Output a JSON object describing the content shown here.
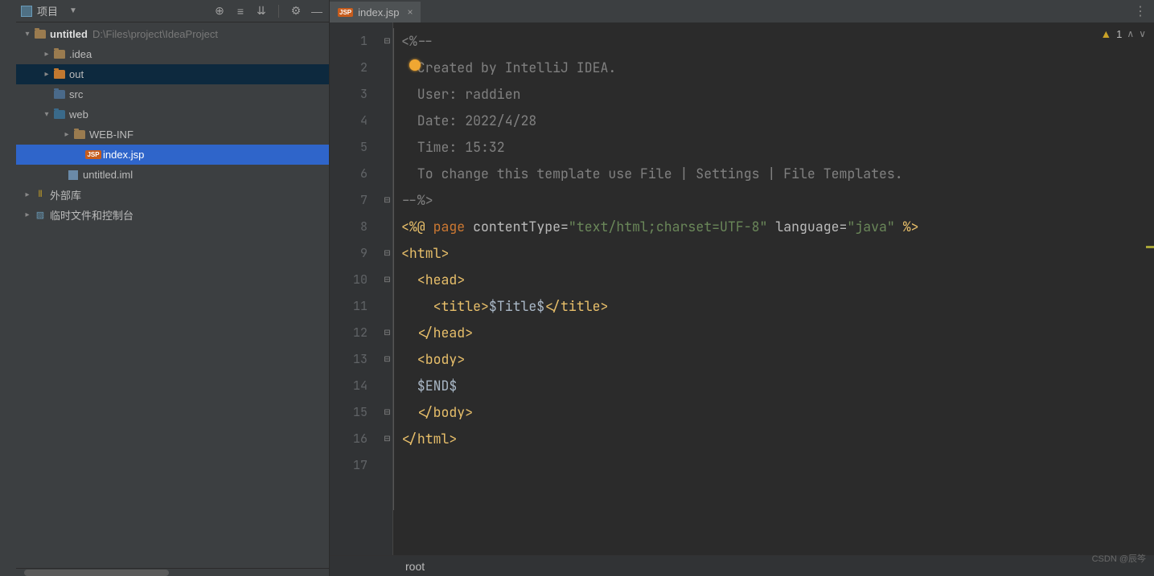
{
  "panel": {
    "title": "项目"
  },
  "tree": {
    "root": {
      "name": "untitled",
      "path": "D:\\Files\\project\\IdeaProject"
    },
    "idea": ".idea",
    "out": "out",
    "src": "src",
    "web": "web",
    "webinf": "WEB-INF",
    "indexjsp": "index.jsp",
    "iml": "untitled.iml",
    "extlib": "外部库",
    "scratch": "临时文件和控制台"
  },
  "tab": {
    "filename": "index.jsp"
  },
  "inspection": {
    "count": "1"
  },
  "breadcrumb": {
    "value": "root"
  },
  "watermark": "CSDN @辰笒",
  "code": {
    "l1": "<%--",
    "l2": "  Created by IntelliJ IDEA.",
    "l3": "  User: raddien",
    "l4": "  Date: 2022/4/28",
    "l5": "  Time: 15:32",
    "l6": "  To change this template use File | Settings | File Templates.",
    "l7": "--%>",
    "l8_a": "<%@ ",
    "l8_kw": "page",
    "l8_b": " contentType=",
    "l8_s1": "\"text/html;charset=UTF-8\"",
    "l8_c": " language=",
    "l8_s2": "\"java\"",
    "l8_d": " %>",
    "l9_a": "<",
    "l9_b": "html",
    "l9_c": ">",
    "l10_a": "  <",
    "l10_b": "head",
    "l10_c": ">",
    "l11_a": "    <",
    "l11_b": "title",
    "l11_c": ">",
    "l11_txt": "$Title$",
    "l11_d": "</",
    "l11_e": "title",
    "l11_f": ">",
    "l12_a": "  </",
    "l12_b": "head",
    "l12_c": ">",
    "l13_a": "  <",
    "l13_b": "body",
    "l13_c": ">",
    "l14": "  $END$",
    "l15_a": "  </",
    "l15_b": "body",
    "l15_c": ">",
    "l16_a": "</",
    "l16_b": "html",
    "l16_c": ">",
    "l17": ""
  }
}
